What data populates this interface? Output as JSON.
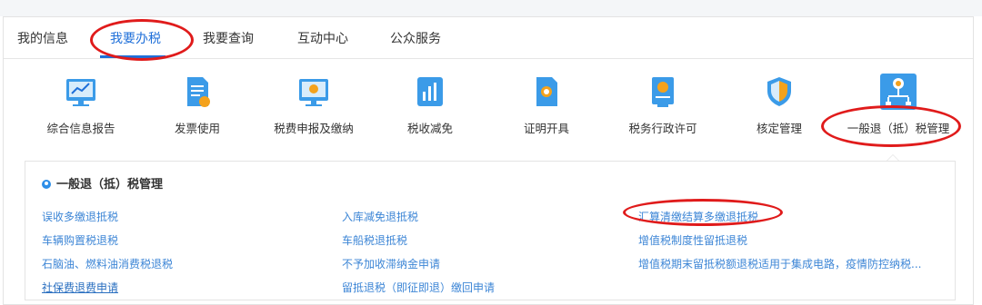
{
  "tabs": [
    {
      "label": "我的信息"
    },
    {
      "label": "我要办税"
    },
    {
      "label": "我要查询"
    },
    {
      "label": "互动中心"
    },
    {
      "label": "公众服务"
    }
  ],
  "services": [
    {
      "label": "综合信息报告",
      "icon": "report-monitor-icon"
    },
    {
      "label": "发票使用",
      "icon": "invoice-icon"
    },
    {
      "label": "税费申报及缴纳",
      "icon": "tax-declaration-monitor-icon"
    },
    {
      "label": "税收减免",
      "icon": "tax-relief-chart-icon"
    },
    {
      "label": "证明开具",
      "icon": "certificate-icon"
    },
    {
      "label": "税务行政许可",
      "icon": "permit-icon"
    },
    {
      "label": "核定管理",
      "icon": "shield-icon"
    },
    {
      "label": "一般退（抵）税管理",
      "icon": "refund-management-icon"
    }
  ],
  "panel": {
    "title": "一般退（抵）税管理",
    "links": [
      [
        "误收多缴退抵税",
        "入库减免退抵税",
        "汇算清缴结算多缴退抵税"
      ],
      [
        "车辆购置税退税",
        "车船税退抵税",
        "增值税制度性留抵退税"
      ],
      [
        "石脑油、燃料油消费税退税",
        "不予加收滞纳金申请",
        "增值税期末留抵税额退税适用于集成电路，疫情防控纳税..."
      ],
      [
        "社保费退费申请",
        "留抵退税（即征即退）缴回申请"
      ]
    ]
  },
  "colors": {
    "accent": "#1e6fd9",
    "link": "#3d86d6",
    "annotation": "#e01b1b",
    "icon_bg": "#3b9be8"
  }
}
